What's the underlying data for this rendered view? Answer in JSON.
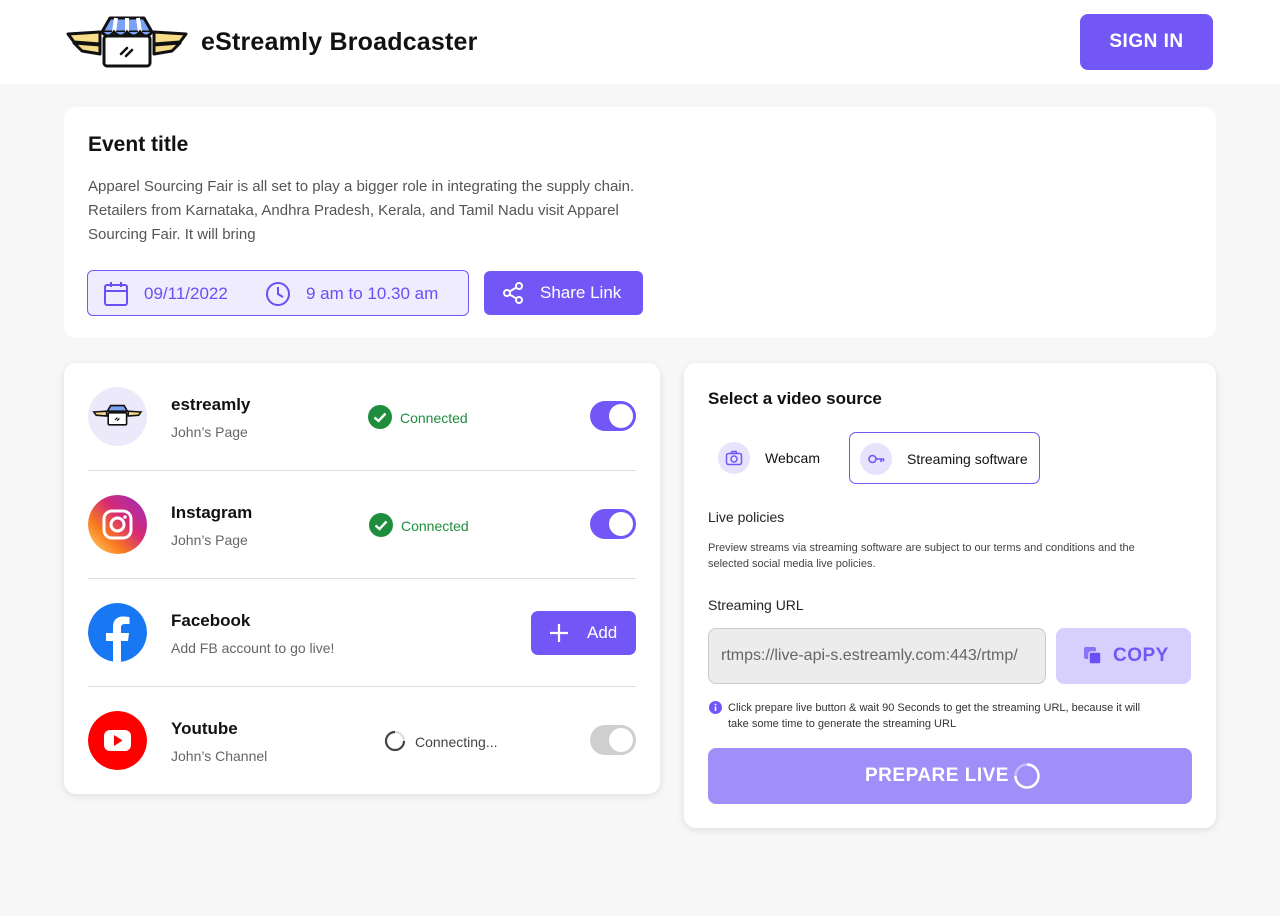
{
  "header": {
    "brand": "eStreamly Broadcaster",
    "sign_in_label": "SIGN IN"
  },
  "event": {
    "title": "Event title",
    "description_lines": [
      "Apparel Sourcing Fair is all set to play a bigger role in integrating the supply chain.",
      "Retailers from Karnataka, Andhra Pradesh, Kerala, and Tamil Nadu visit Apparel",
      "Sourcing Fair. It will bring"
    ],
    "date": "09/11/2022",
    "time": "9 am to 10.30 am",
    "share_label": "Share Link",
    "icons": {
      "date": "calendar-icon",
      "time": "clock-icon",
      "share": "share-icon"
    }
  },
  "accounts": [
    {
      "name": "estreamly",
      "sub": "John’s Page",
      "status": "Connected",
      "toggle_on": true,
      "icon": "estreamly-logo-icon"
    },
    {
      "name": "Instagram",
      "sub": "John’s Page",
      "status": "Connected",
      "toggle_on": true,
      "icon": "instagram-icon"
    },
    {
      "name": "Facebook",
      "sub": "Add FB account to go live!",
      "action_label": "Add",
      "icon": "facebook-icon"
    },
    {
      "name": "Youtube",
      "sub": "John’s Channel",
      "status": "Connecting...",
      "toggle_on": false,
      "icon": "youtube-icon"
    }
  ],
  "video_source": {
    "title": "Select a video source",
    "options": [
      {
        "label": "Webcam",
        "icon": "camera-icon",
        "selected": false
      },
      {
        "label": "Streaming software",
        "icon": "key-icon",
        "selected": true
      }
    ],
    "policies_label": "Live policies",
    "policies_lines": [
      "Preview streams via streaming software are subject to our terms and conditions and the",
      "selected social media live policies."
    ],
    "url_label": "Streaming URL",
    "url_value": "rtmps://live-api-s.estreamly.com:443/rtmp/",
    "copy_label": "COPY",
    "info_lines": [
      "Click prepare live button & wait 90 Seconds to get the streaming URL, because it will",
      "take some time to generate the streaming URL"
    ],
    "prepare_label": "PREPARE LIVE"
  },
  "colors": {
    "accent": "#7357f6",
    "accent_light": "#efecfe",
    "connected": "#1e8e3e",
    "facebook": "#1877f2",
    "youtube": "#ff0000",
    "toggle_off": "#cfcfcf"
  }
}
